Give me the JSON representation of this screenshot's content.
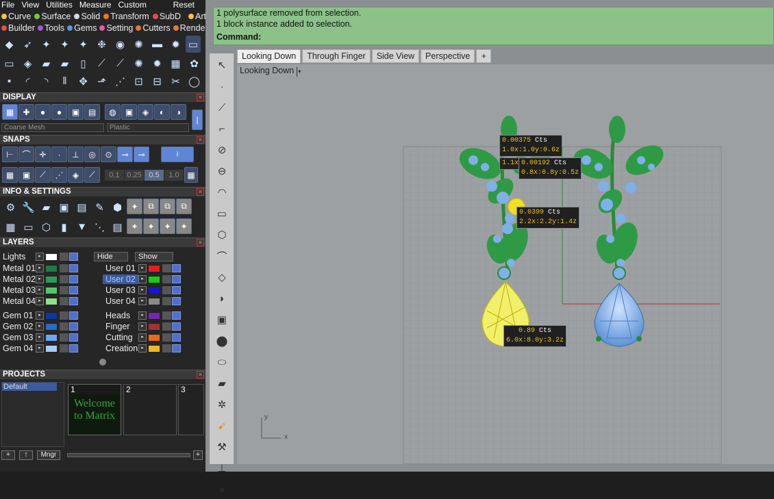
{
  "menu": {
    "items": [
      "File",
      "View",
      "Utilities",
      "Measure",
      "Custom"
    ],
    "reset": "Reset"
  },
  "tabs_row1": [
    {
      "label": "Curve",
      "color": "#f1c24a"
    },
    {
      "label": "Surface",
      "color": "#7bc34c"
    },
    {
      "label": "Solid",
      "color": "#d9d9d9"
    },
    {
      "label": "Transform",
      "color": "#e8753a"
    },
    {
      "label": "SubD",
      "color": "#e25050"
    },
    {
      "label": "Art",
      "color": "#f1c24a"
    }
  ],
  "tabs_row2": [
    {
      "label": "Builder",
      "color": "#e25050"
    },
    {
      "label": "Tools",
      "color": "#a855d6"
    },
    {
      "label": "Gems",
      "color": "#5b9ae0"
    },
    {
      "label": "Setting",
      "color": "#e85aa6"
    },
    {
      "label": "Cutters",
      "color": "#e8753a"
    },
    {
      "label": "Render",
      "color": "#e8753a"
    }
  ],
  "display": {
    "title": "DISPLAY",
    "mesh_select": "Coarse Mesh",
    "material_select": "Plastic"
  },
  "snaps": {
    "title": "SNAPS",
    "tolerances": [
      "0.1",
      "0.25",
      "0.5",
      "1.0"
    ]
  },
  "info": {
    "title": "INFO & SETTINGS"
  },
  "layers": {
    "title": "LAYERS",
    "lights": "Lights",
    "hide": "Hide",
    "show": "Show",
    "left": [
      {
        "name": "Metal 01",
        "color": "#1f7a45"
      },
      {
        "name": "Metal 02",
        "color": "#2e9a5a"
      },
      {
        "name": "Metal 03",
        "color": "#57c46e"
      },
      {
        "name": "Metal 04",
        "color": "#8ee08e"
      },
      {
        "name": "Gem 01",
        "color": "#0b3a9a"
      },
      {
        "name": "Gem 02",
        "color": "#2c6ac9"
      },
      {
        "name": "Gem 03",
        "color": "#6fa5ee"
      },
      {
        "name": "Gem 04",
        "color": "#a8ccf5"
      }
    ],
    "right": [
      {
        "name": "User 01",
        "color": "#e81d1d"
      },
      {
        "name": "User 02",
        "color": "#12d012"
      },
      {
        "name": "User 03",
        "color": "#1515d6"
      },
      {
        "name": "User 04",
        "color": "#8a8a8a"
      },
      {
        "name": "Heads",
        "color": "#7a25b0"
      },
      {
        "name": "Finger",
        "color": "#a33232"
      },
      {
        "name": "Cutting",
        "color": "#e86a1a"
      },
      {
        "name": "Creation",
        "color": "#f0b81e"
      }
    ]
  },
  "projects": {
    "title": "PROJECTS",
    "list": [
      "Default"
    ],
    "slots": [
      "1",
      "2",
      "3"
    ],
    "thumb_text": "Welcome to Matrix",
    "manager": "Mngr"
  },
  "command": {
    "line1": "1 polysurface removed from selection.",
    "line2": "1 block instance added to selection.",
    "prompt": "Command:"
  },
  "viewport": {
    "tabs": [
      "Looking Down",
      "Through Finger",
      "Side View",
      "Perspective"
    ],
    "label": "Looking Down",
    "axis_y": "y",
    "axis_x": "x"
  },
  "tooltips": [
    {
      "cts": "0.00375",
      "unit": "Cts",
      "dims": "1.0x:1.0y:0.6z"
    },
    {
      "cts": "0.00192",
      "unit": "Cts",
      "dims": "0.8x:0.8y:0.5z",
      "prefix": "1.1x"
    },
    {
      "cts": "0.0399",
      "unit": "Cts",
      "dims": "2.2x:2.2y:1.4z"
    },
    {
      "cts": "0.89",
      "unit": "Cts",
      "dims": "6.0x:8.0y:3.2z"
    }
  ]
}
